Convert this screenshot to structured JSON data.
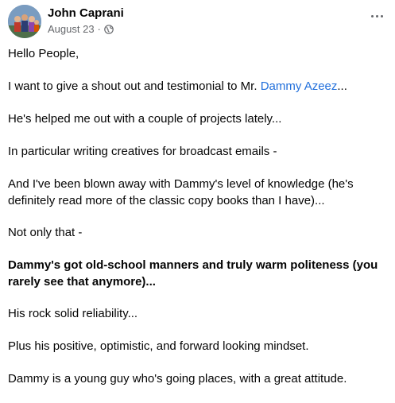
{
  "post": {
    "author": {
      "name": "John Caprani",
      "avatar_icon": "profile-photo"
    },
    "meta": {
      "date": "August 23",
      "separator": "·",
      "privacy_icon": "globe-icon"
    },
    "more_icon": "more-options-icon",
    "paragraphs": {
      "p1": "Hello People,",
      "p2_before": "I want to give a shout out and testimonial to Mr. ",
      "p2_mention": "Dammy Azeez",
      "p2_after": "...",
      "p3": "He's helped me out with a couple of projects lately...",
      "p4": "In particular writing creatives for broadcast emails -",
      "p5": "And I've been blown away with Dammy's level of knowledge (he's definitely read more of the classic copy books than I have)...",
      "p6": "Not only that -",
      "p7": "Dammy's got old-school manners and truly warm politeness (you rarely see that anymore)...",
      "p8": "His rock solid reliability...",
      "p9": "Plus his positive, optimistic, and forward looking mindset.",
      "p10": "Dammy is a young guy who's going places, with a great attitude."
    },
    "colors": {
      "mention": "#216fdb",
      "meta_text": "#65676b",
      "body_text": "#050505"
    }
  }
}
